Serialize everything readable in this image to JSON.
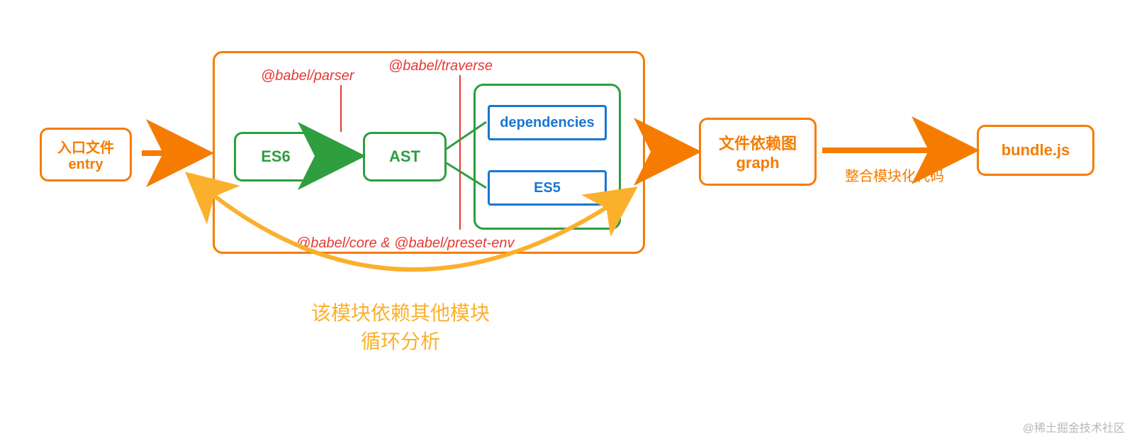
{
  "entry": {
    "line1": "入口文件",
    "line2": "entry"
  },
  "process": {
    "es6": "ES6",
    "ast": "AST",
    "dependencies": "dependencies",
    "es5": "ES5",
    "parser_label": "@babel/parser",
    "traverse_label": "@babel/traverse",
    "core_label": "@babel/core & @babel/preset-env"
  },
  "graph": {
    "line1": "文件依赖图",
    "line2": "graph"
  },
  "bundle": {
    "label": "bundle.js"
  },
  "arrow_label": "整合模块化代码",
  "loop": {
    "line1": "该模块依赖其他模块",
    "line2": "循环分析"
  },
  "watermark": "@稀土掘金技术社区"
}
